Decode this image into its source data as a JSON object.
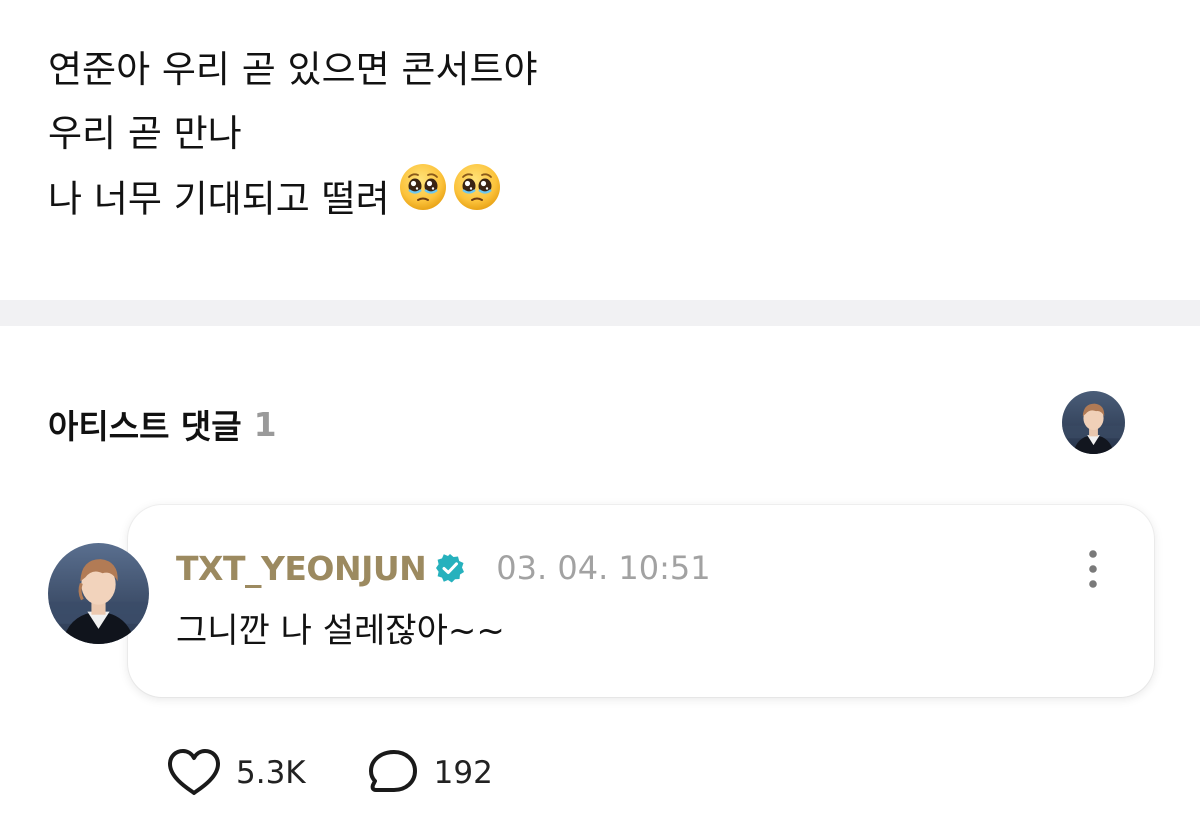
{
  "post": {
    "lines": [
      "연준아 우리 곧 있으면 콘서트야",
      "우리 곧 만나",
      "나 너무 기대되고 떨려"
    ],
    "trailing_emojis": [
      "pleading-face-icon",
      "pleading-face-icon"
    ]
  },
  "artist_comments": {
    "title": "아티스트 댓글",
    "count": "1",
    "header_avatar": "artist-avatar"
  },
  "comment": {
    "author": "TXT_YEONJUN",
    "verified_icon": "verified-badge-icon",
    "timestamp": "03. 04. 10:51",
    "text": "그니깐 나 설레잖아~~",
    "more_icon": "more-vertical-icon"
  },
  "actions": {
    "likes": "5.3K",
    "comments": "192",
    "like_icon": "heart-outline-icon",
    "comment_icon": "speech-bubble-icon"
  },
  "colors": {
    "author": "#9c8a60",
    "verified": "#26b1bd",
    "count_gray": "#9a9a9a",
    "timestamp_gray": "#a2a2a2",
    "separator": "#f1f1f3"
  }
}
